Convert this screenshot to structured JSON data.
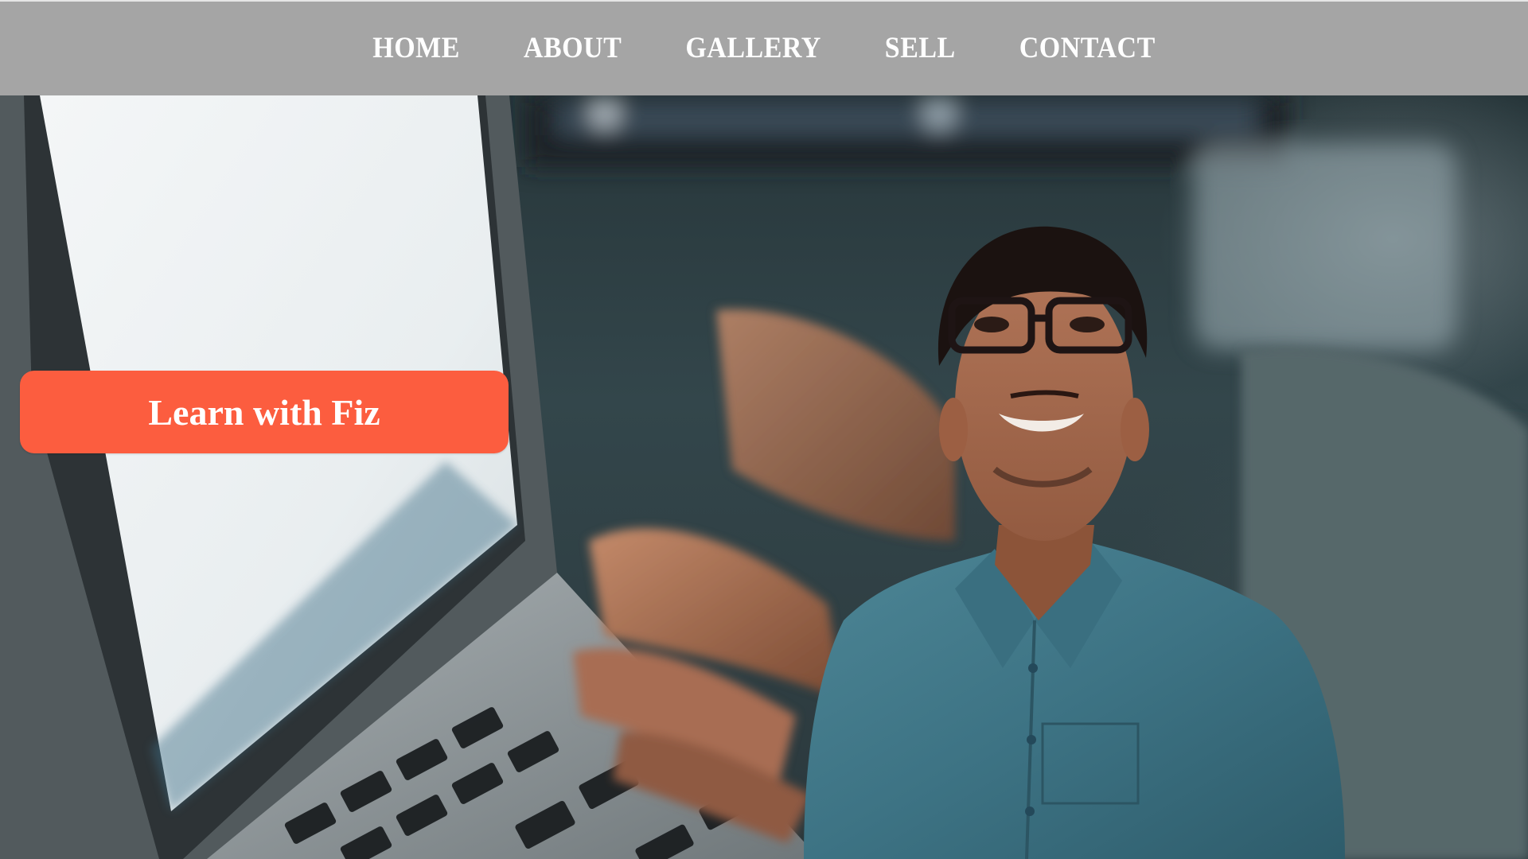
{
  "nav": {
    "items": [
      {
        "label": "HOME"
      },
      {
        "label": "ABOUT"
      },
      {
        "label": "GALLERY"
      },
      {
        "label": "SELL"
      },
      {
        "label": "CONTACT"
      }
    ]
  },
  "hero": {
    "cta_label": "Learn with Fiz",
    "background_image": "laptop-typing-photo",
    "portrait_image": "smiling-man-with-glasses-portrait"
  },
  "colors": {
    "nav_background": "#a5a5a5",
    "nav_text": "#ffffff",
    "cta_background": "#fc5d3f",
    "cta_text": "#ffffff"
  }
}
